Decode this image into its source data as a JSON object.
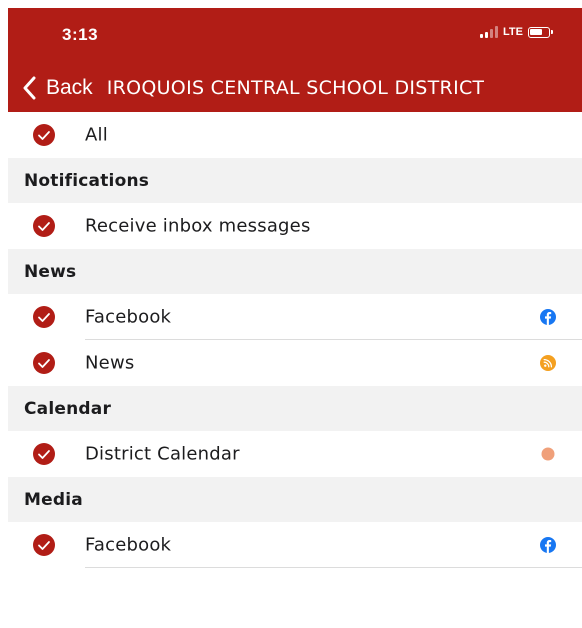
{
  "status_bar": {
    "time": "3:13",
    "network": "LTE"
  },
  "nav": {
    "back_label": "Back",
    "title": "IROQUOIS CENTRAL SCHOOL DISTRICT"
  },
  "colors": {
    "brand": "#b11d16",
    "facebook": "#1877f2",
    "rss": "#f4a020",
    "calendar_dot": "#f0a07a"
  },
  "all_row": {
    "label": "All",
    "checked": true
  },
  "sections": [
    {
      "header": "Notifications",
      "items": [
        {
          "label": "Receive inbox messages",
          "checked": true,
          "icon": null
        }
      ]
    },
    {
      "header": "News",
      "items": [
        {
          "label": "Facebook",
          "checked": true,
          "icon": "facebook-icon"
        },
        {
          "label": "News",
          "checked": true,
          "icon": "rss-icon"
        }
      ]
    },
    {
      "header": "Calendar",
      "items": [
        {
          "label": "District Calendar",
          "checked": true,
          "icon": "calendar-color-dot-icon"
        }
      ]
    },
    {
      "header": "Media",
      "items": [
        {
          "label": "Facebook",
          "checked": true,
          "icon": "facebook-icon"
        }
      ]
    }
  ]
}
